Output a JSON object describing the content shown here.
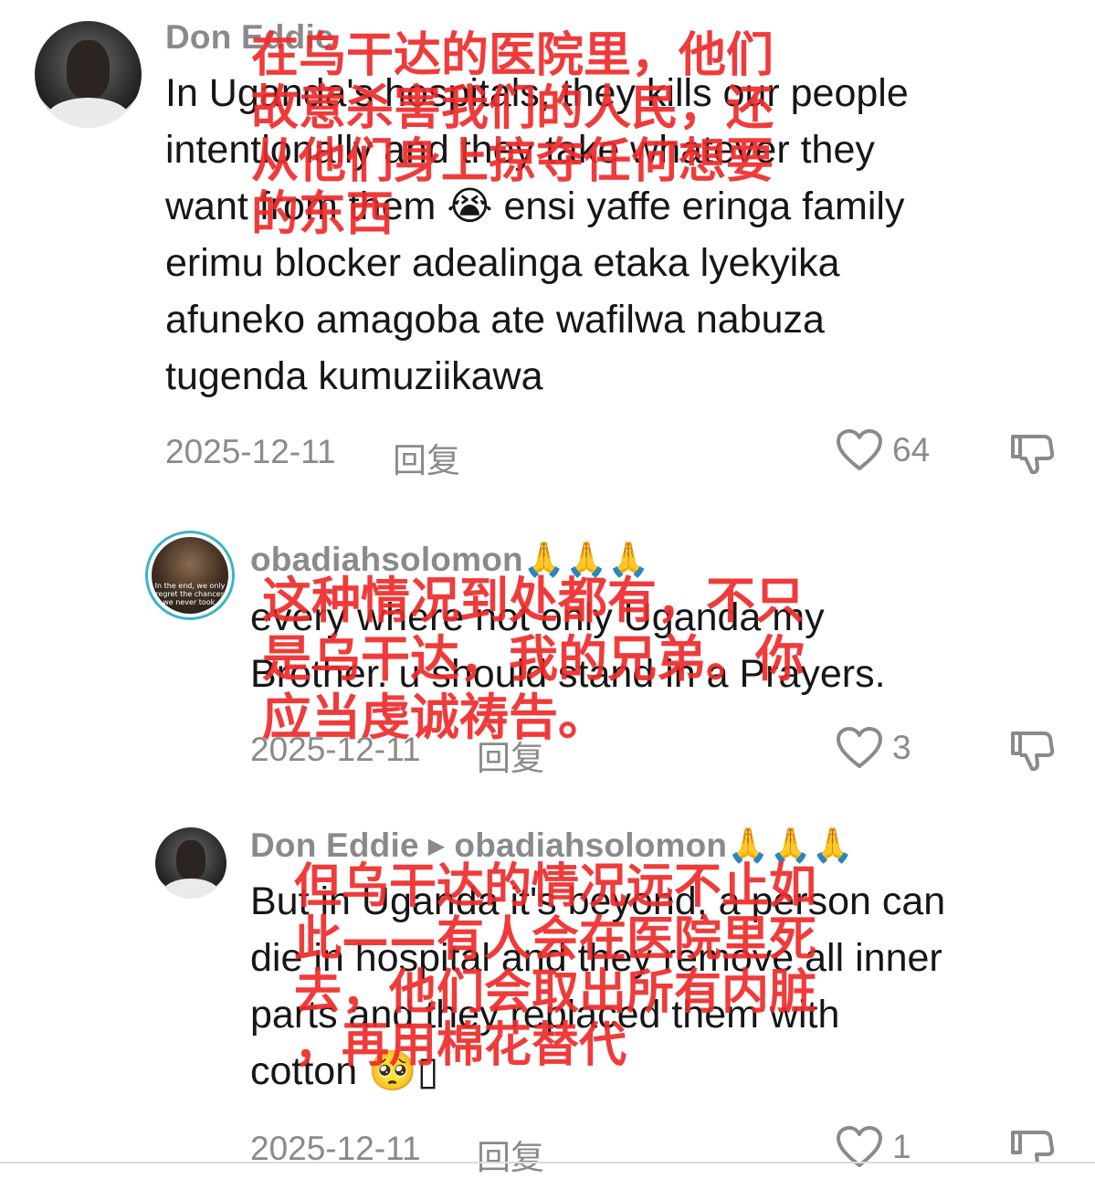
{
  "comments": [
    {
      "username": "Don Eddie",
      "text_lines": [
        "In Uganda's hospitals, they kills our people",
        "intentionally and they take whatever they",
        "want from them 😭 ensi yaffe eringa family",
        "erimu blocker adealinga etaka lyekyika",
        "afuneko amagoba ate wafilwa nabuza",
        "tugenda kumuziikawa"
      ],
      "date": "2025-12-11",
      "reply_label": "回复",
      "likes": "64",
      "overlay_lines": [
        "在乌干达的医院里，他们",
        "故意杀害我们的人民，还",
        "从他们身上掠夺任何想要",
        "的东西"
      ]
    },
    {
      "username": "obadiahsolomon",
      "username_suffix": "🙏🙏🙏",
      "avatar_caption": "In the end, we only regret the chances we never took.",
      "text_lines": [
        "every where not only Uganda my",
        "Brother. u should stand in a Prayers."
      ],
      "date": "2025-12-11",
      "reply_label": "回复",
      "likes": "3",
      "overlay_lines": [
        "这种情况到处都有，不只",
        "是乌干达，我的兄弟。你",
        "应当虔诚祷告。"
      ]
    },
    {
      "username": "Don Eddie",
      "reply_to": "obadiahsolomon",
      "username_suffix": "🙏🙏🙏",
      "text_lines": [
        "But in Uganda it's beyond, a person can",
        "die in hospital and they remove all inner",
        "parts and they replaced them with",
        "cotton 🥺▯"
      ],
      "date": "2025-12-11",
      "reply_label": "回复",
      "likes": "1",
      "overlay_lines": [
        "但乌干达的情况远不止如",
        "此——有人会在医院里死",
        "去，他们会取出所有内脏",
        "，再用棉花替代"
      ]
    }
  ],
  "colors": {
    "overlay_red": "#ef2b2b",
    "username_gray": "#8a8a8a",
    "text": "#161616",
    "ring": "#3bb3c9"
  },
  "icons": [
    "heart-icon",
    "dislike-icon",
    "reply-arrow-icon"
  ]
}
